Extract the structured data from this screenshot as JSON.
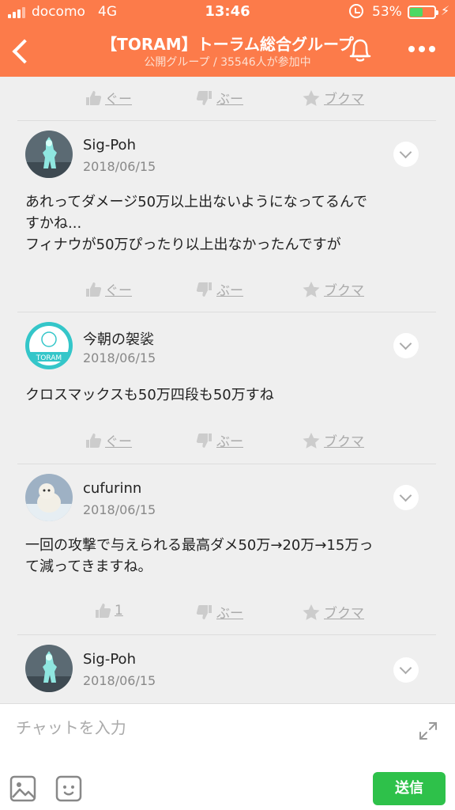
{
  "status": {
    "carrier": "docomo",
    "network": "4G",
    "time": "13:46",
    "battery": "53%",
    "battery_level": 0.53
  },
  "header": {
    "title": "【TORAM】トーラム総合グループ",
    "subtitle": "公開グループ / 35546人が参加中"
  },
  "reactions_top": {
    "good": "ぐー",
    "bad": "ぶー",
    "fav": "ブクマ"
  },
  "posts": [
    {
      "user": "Sig-Poh",
      "date": "2018/06/15",
      "text": "あれってダメージ50万以上出ないようになってるんで\nすかね...\nフィナウが50万ぴったり以上出なかったんですが",
      "good": "ぐー",
      "bad": "ぶー",
      "fav": "ブクマ"
    },
    {
      "user": "今朝の袈裟",
      "date": "2018/06/15",
      "text": "クロスマックスも50万四段も50万すね",
      "good": "ぐー",
      "bad": "ぶー",
      "fav": "ブクマ"
    },
    {
      "user": "cufurinn",
      "date": "2018/06/15",
      "text": "一回の攻撃で与えられる最高ダメ50万→20万→15万っ\nて減ってきますね。",
      "good": "1",
      "bad": "ぶー",
      "fav": "ブクマ"
    },
    {
      "user": "Sig-Poh",
      "date": "2018/06/15"
    }
  ],
  "composer": {
    "placeholder": "チャットを入力",
    "send": "送信"
  },
  "colors": {
    "header": "#fc7b4a",
    "send": "#2ec14a",
    "battery": "#4cd964"
  }
}
